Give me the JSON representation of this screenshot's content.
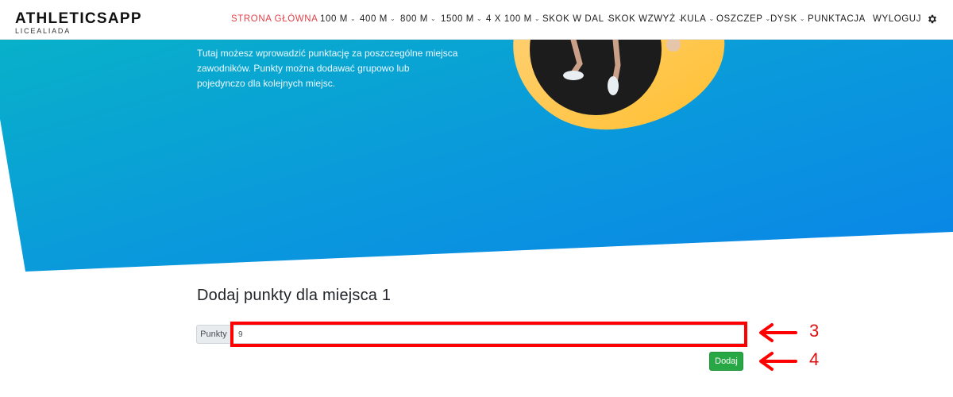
{
  "header": {
    "brand_title": "ATHLETICSAPP",
    "brand_subtitle": "LICEALIADA",
    "nav": [
      {
        "label": "STRONA GŁÓWNA",
        "dropdown": false,
        "active": true
      },
      {
        "label": "100 M",
        "dropdown": true,
        "active": false
      },
      {
        "label": "400 M",
        "dropdown": true,
        "active": false
      },
      {
        "label": "800 M",
        "dropdown": true,
        "active": false
      },
      {
        "label": "1500 M",
        "dropdown": true,
        "active": false
      },
      {
        "label": "4 X 100 M",
        "dropdown": true,
        "active": false
      },
      {
        "label": "SKOK W DAL",
        "dropdown": true,
        "active": false
      },
      {
        "label": "SKOK WZWYŻ",
        "dropdown": true,
        "active": false
      },
      {
        "label": "KULA",
        "dropdown": true,
        "active": false
      },
      {
        "label": "OSZCZEP",
        "dropdown": true,
        "active": false
      },
      {
        "label": "DYSK",
        "dropdown": true,
        "active": false
      },
      {
        "label": "PUNKTACJA",
        "dropdown": false,
        "active": false
      },
      {
        "label": "WYLOGUJ",
        "dropdown": false,
        "active": false
      }
    ],
    "settings_icon": "gear-icon",
    "caret_glyph": "⌄"
  },
  "hero": {
    "description": "Tutaj możesz wprowadzić punktację za poszczególne miejsca zawodników. Punkty można dodawać grupowo lub pojedynczo dla kolejnych miejsc."
  },
  "form": {
    "title": "Dodaj punkty dla miejsca 1",
    "addon_label": "Punkty",
    "points_value": "9",
    "submit_label": "Dodaj"
  },
  "annotations": [
    {
      "number": "3"
    },
    {
      "number": "4"
    }
  ],
  "colors": {
    "active_nav": "#e0434a",
    "hero_gradient_start": "#06b3c6",
    "hero_gradient_end": "#0a86e8",
    "accent_yellow": "#ffc23a",
    "button_green": "#28a745",
    "annotation_red": "#ff0000"
  }
}
